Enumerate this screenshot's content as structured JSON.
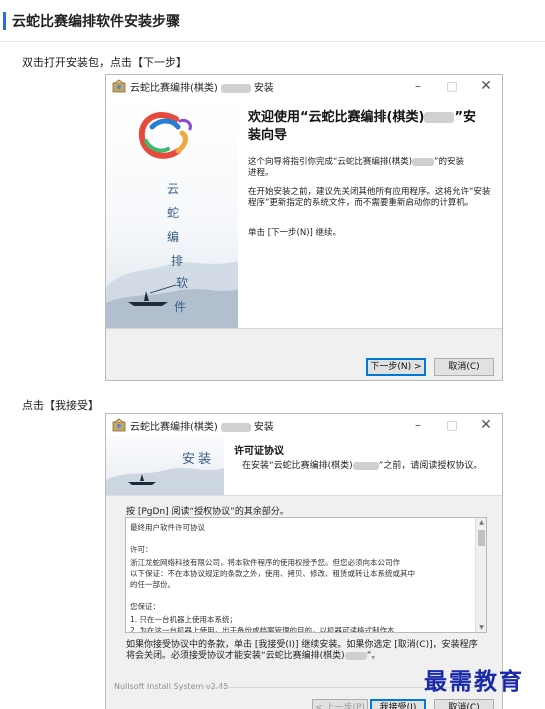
{
  "page": {
    "title": "云蛇比赛编排软件安装步骤",
    "step1_text": "双击打开安装包，点击【下一步】",
    "step2_text": "点击【我接受】"
  },
  "installer_welcome": {
    "window_title_prefix": "云蛇比赛编排(棋类)",
    "window_title_suffix": "安装",
    "heading_line1": "欢迎使用“云蛇比赛编排(棋类)",
    "heading_line1_end": "”安",
    "heading_line2": "装向导",
    "para1_a": "这个向导将指引你完成“云蛇比赛编排(棋类)",
    "para1_b": "”的安装",
    "para1_c": "进程。",
    "para2": "在开始安装之前，建议先关闭其他所有应用程序。这将允许“安装程序”更新指定的系统文件，而不需要重新启动你的计算机。",
    "para3": "单击 [下一步(N)] 继续。",
    "side_text": [
      "云",
      "蛇",
      "编",
      "排",
      "软",
      "件"
    ],
    "next_button": "下一步(N) >",
    "cancel_button": "取消(C)"
  },
  "installer_license": {
    "window_title_prefix": "云蛇比赛编排(棋类)",
    "window_title_suffix": "安装",
    "banner_text": "安装",
    "license_title": "许可证协议",
    "license_sub_a": "在安装“云蛇比赛编排(棋类)",
    "license_sub_b": "”之前，请阅读授权协议。",
    "press_text": "按 [PgDn] 阅读“授权协议”的其余部分。",
    "license_lines": [
      "最终用户软件许可协议",
      "许可：",
      "    浙江龙蛇网络科技有限公司，将本软件程序的使用权授予您。但您必须向本公司作",
      "以下保证：不在本协议规定的条款之外，使用、拷贝、修改、租赁或转让本系统或其中",
      "的任一部份。",
      "您保证：",
      "    1.    只在一台机器上使用本系统；",
      "    2.    为在这一台机器上使用，出于备份或档案管理的目的，以机器可读格式制作本"
    ],
    "accept_text_a": "如果你接受协议中的条款，单击 [我接受(I)] 继续安装。如果你选定 [取消(C)]，安装程序将会关闭。必须接受协议才能安装“云蛇比赛编排(棋类)",
    "accept_text_b": "”。",
    "nsis_text": "Nullsoft Install System v2.45",
    "back_button": "< 上一步(P)",
    "accept_button": "我接受(I)",
    "cancel_button": "取消(C)"
  },
  "watermark": "最需教育",
  "colors": {
    "accent": "#2b6fd6",
    "watermark": "#1a2aa8",
    "primary_button_border": "#0078d7"
  }
}
